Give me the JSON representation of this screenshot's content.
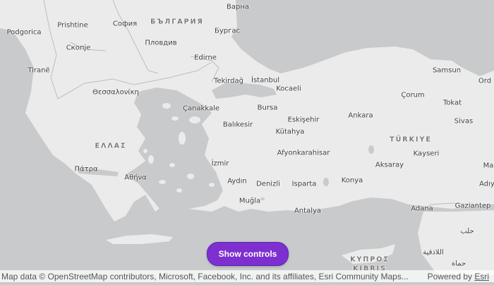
{
  "map": {
    "land_color": "#ebebeb",
    "water_color": "#c8cacc",
    "border_color": "#bdbdbd",
    "country_labels": [
      {
        "key": "bulgaria",
        "text": "БЪЛГАРИЯ"
      },
      {
        "key": "greece",
        "text": "ΕΛΛΑΣ"
      },
      {
        "key": "turkey",
        "text": "TÜRKIYE"
      },
      {
        "key": "cyprus",
        "text": "ΚΥΠΡΟΣ"
      },
      {
        "key": "cyprus2",
        "text": "KIBRIS"
      }
    ],
    "city_labels": [
      {
        "key": "varna",
        "text": "Варна"
      },
      {
        "key": "podgorica",
        "text": "Podgorica"
      },
      {
        "key": "prishtine",
        "text": "Prishtine"
      },
      {
        "key": "sofia",
        "text": "София"
      },
      {
        "key": "burgas",
        "text": "Бургас"
      },
      {
        "key": "skopje",
        "text": "Скопје"
      },
      {
        "key": "plovdiv",
        "text": "Пловдив"
      },
      {
        "key": "edirne",
        "text": "Edirne"
      },
      {
        "key": "tirane",
        "text": "Tiranë"
      },
      {
        "key": "tekirdag",
        "text": "Tekirdağ"
      },
      {
        "key": "istanbul",
        "text": "İstanbul"
      },
      {
        "key": "samsun",
        "text": "Samsun"
      },
      {
        "key": "ordu",
        "text": "Ord"
      },
      {
        "key": "kocaeli",
        "text": "Kocaeli"
      },
      {
        "key": "thessaloniki",
        "text": "Θεσσαλονίκη"
      },
      {
        "key": "corum",
        "text": "Çorum"
      },
      {
        "key": "canakkale",
        "text": "Çanakkale"
      },
      {
        "key": "bursa",
        "text": "Bursa"
      },
      {
        "key": "tokat",
        "text": "Tokat"
      },
      {
        "key": "eskisehir",
        "text": "Eskişehir"
      },
      {
        "key": "ankara",
        "text": "Ankara"
      },
      {
        "key": "balikesir",
        "text": "Balıkesir"
      },
      {
        "key": "sivas",
        "text": "Sivas"
      },
      {
        "key": "kutahya",
        "text": "Kütahya"
      },
      {
        "key": "afyonkarahisar",
        "text": "Afyonkarahisar"
      },
      {
        "key": "kayseri",
        "text": "Kayseri"
      },
      {
        "key": "izmir",
        "text": "İzmir"
      },
      {
        "key": "aksaray",
        "text": "Aksaray"
      },
      {
        "key": "malatya",
        "text": "Ma"
      },
      {
        "key": "patra",
        "text": "Πάτρα"
      },
      {
        "key": "athina",
        "text": "Αθήνα"
      },
      {
        "key": "aydin",
        "text": "Aydın"
      },
      {
        "key": "denizli",
        "text": "Denizli"
      },
      {
        "key": "isparta",
        "text": "Isparta"
      },
      {
        "key": "konya",
        "text": "Konya"
      },
      {
        "key": "adiyaman",
        "text": "Adıy"
      },
      {
        "key": "mugla",
        "text": "Muğla"
      },
      {
        "key": "adana",
        "text": "Adana"
      },
      {
        "key": "gaziantep",
        "text": "Gaziantep"
      },
      {
        "key": "antalya",
        "text": "Antalya"
      },
      {
        "key": "halab",
        "text": "حلب"
      },
      {
        "key": "ladhiqiyah",
        "text": "اللاذقية"
      },
      {
        "key": "hama",
        "text": "حماة"
      }
    ]
  },
  "controls": {
    "show_controls_label": "Show controls"
  },
  "attribution": {
    "text": "Map data © OpenStreetMap contributors, Microsoft, Facebook, Inc. and its affiliates, Esri Community Maps...",
    "powered_by_prefix": "Powered by ",
    "powered_by_link": "Esri"
  }
}
